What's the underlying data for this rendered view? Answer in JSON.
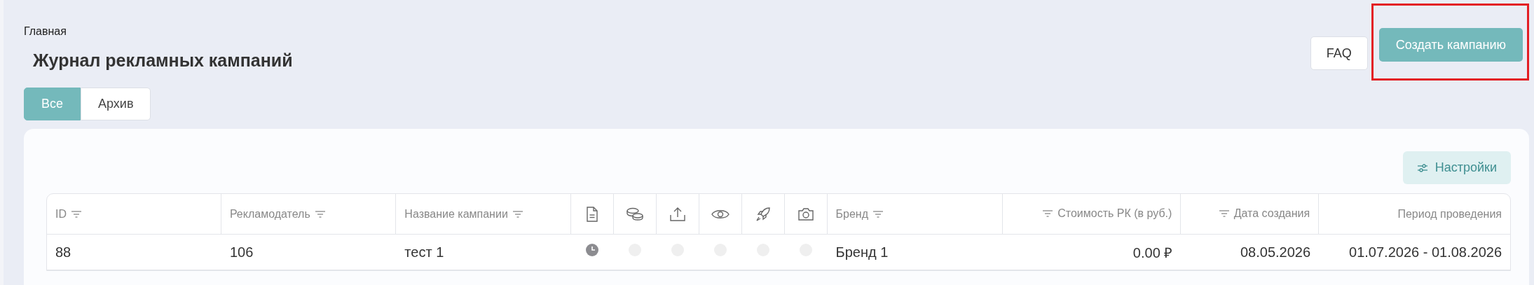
{
  "breadcrumb": "Главная",
  "title": "Журнал рекламных кампаний",
  "actions": [
    {
      "label": "FAQ",
      "kind": "secondary",
      "highlighted": false
    },
    {
      "label": "Создать кампанию",
      "kind": "primary",
      "highlighted": true
    }
  ],
  "tabs": [
    {
      "label": "Все",
      "selected": true
    },
    {
      "label": "Архив",
      "selected": false
    }
  ],
  "settings_button": "Настройки",
  "table": {
    "columns": [
      {
        "label": "ID",
        "kind": "text",
        "filterable": true
      },
      {
        "label": "Рекламодатель",
        "kind": "text",
        "filterable": true
      },
      {
        "label": "Название кампании",
        "kind": "text",
        "filterable": true
      },
      {
        "kind": "icon"
      },
      {
        "kind": "icon"
      },
      {
        "kind": "icon"
      },
      {
        "kind": "icon"
      },
      {
        "kind": "icon"
      },
      {
        "kind": "icon"
      },
      {
        "label": "Бренд",
        "kind": "text",
        "filterable": true
      },
      {
        "label": "Стоимость РК (в руб.)",
        "kind": "number",
        "filterable": true
      },
      {
        "label": "Дата создания",
        "kind": "number",
        "filterable": true
      },
      {
        "label": "Период проведения",
        "kind": "number",
        "filterable": false
      }
    ],
    "rows": [
      {
        "cells": [
          {
            "text": "88"
          },
          {
            "text": "106"
          },
          {
            "text": "тест 1"
          },
          {
            "filled": true
          },
          {
            "filled": false
          },
          {
            "filled": false
          },
          {
            "filled": false
          },
          {
            "filled": false
          },
          {
            "filled": false
          },
          {
            "text": "Бренд 1"
          },
          {
            "text": "0.00 ₽"
          },
          {
            "text": "08.05.2026"
          },
          {
            "text": "01.07.2026 - 01.08.2026"
          }
        ]
      }
    ]
  }
}
